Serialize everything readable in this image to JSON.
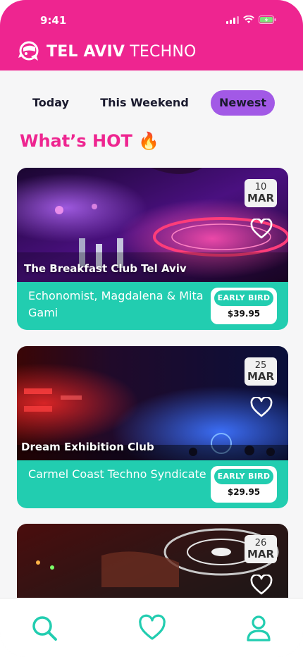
{
  "status_bar": {
    "time": "9:41"
  },
  "header": {
    "title_bold": "TEL AVIV",
    "title_light": " TECHNO"
  },
  "filters": [
    {
      "label": "Today",
      "active": false
    },
    {
      "label": "This Weekend",
      "active": false
    },
    {
      "label": "Newest",
      "active": true
    }
  ],
  "section": {
    "title": "What’s HOT 🔥"
  },
  "events": [
    {
      "venue": "The Breakfast  Club Tel Aviv",
      "day": "10",
      "month": "MAR",
      "artists": "Echonomist, Magdalena & Mita Gami",
      "ticket_type": "EARLY BIRD",
      "price": "$39.95"
    },
    {
      "venue": "Dream Exhibition Club",
      "day": "25",
      "month": "MAR",
      "artists": "Carmel Coast Techno Syndicate",
      "ticket_type": "EARLY BIRD",
      "price": "$29.95"
    },
    {
      "venue": "",
      "day": "26",
      "month": "MAR",
      "artists": "",
      "ticket_type": "",
      "price": ""
    }
  ],
  "nav": [
    {
      "icon": "search-icon"
    },
    {
      "icon": "heart-icon"
    },
    {
      "icon": "user-icon"
    }
  ],
  "colors": {
    "brand_pink": "#ee2590",
    "accent_teal": "#22cdb0",
    "active_tab": "#a259e6"
  }
}
